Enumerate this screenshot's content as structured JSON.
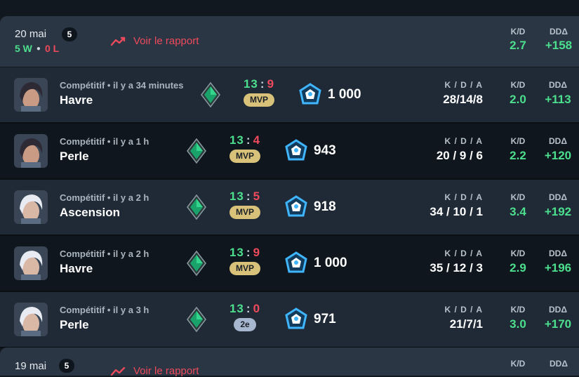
{
  "days": [
    {
      "date": "20 mai",
      "count": "5",
      "wins": "5 W",
      "losses": "0 L",
      "report": "Voir le rapport",
      "kd_label": "K/D",
      "kd": "2.7",
      "dd_label": "DDΔ",
      "dd": "+158"
    },
    {
      "date": "19 mai",
      "count": "5",
      "report": "Voir le rapport",
      "kd_label": "K/D",
      "dd_label": "DDΔ"
    }
  ],
  "matches": [
    {
      "sub": "Compétitif • il y a 34 minutes",
      "map": "Havre",
      "score_w": "13",
      "score_l": "9",
      "pill": "MVP",
      "rr": "1 000",
      "kda_label": "K / D / A",
      "kda": "28/14/8",
      "kd_label": "K/D",
      "kd": "2.0",
      "dd_label": "DDΔ",
      "dd": "+113"
    },
    {
      "sub": "Compétitif • il y a 1 h",
      "map": "Perle",
      "score_w": "13",
      "score_l": "4",
      "pill": "MVP",
      "rr": "943",
      "kda_label": "K / D / A",
      "kda": "20 / 9 / 6",
      "kd_label": "K/D",
      "kd": "2.2",
      "dd_label": "DDΔ",
      "dd": "+120"
    },
    {
      "sub": "Compétitif • il y a 2 h",
      "map": "Ascension",
      "score_w": "13",
      "score_l": "5",
      "pill": "MVP",
      "rr": "918",
      "kda_label": "K / D / A",
      "kda": "34 / 10 / 1",
      "kd_label": "K/D",
      "kd": "3.4",
      "dd_label": "DDΔ",
      "dd": "+192"
    },
    {
      "sub": "Compétitif • il y a 2 h",
      "map": "Havre",
      "score_w": "13",
      "score_l": "9",
      "pill": "MVP",
      "rr": "1 000",
      "kda_label": "K / D / A",
      "kda": "35 / 12 / 3",
      "kd_label": "K/D",
      "kd": "2.9",
      "dd_label": "DDΔ",
      "dd": "+196"
    },
    {
      "sub": "Compétitif • il y a 3 h",
      "map": "Perle",
      "score_w": "13",
      "score_l": "0",
      "pill": "2e",
      "rr": "971",
      "kda_label": "K / D / A",
      "kda": "21/7/1",
      "kd_label": "K/D",
      "kd": "3.0",
      "dd_label": "DDΔ",
      "dd": "+170"
    }
  ],
  "colors": {
    "win": "#4cdf8d",
    "loss": "#ef4a5c",
    "mvp": "#d8c27a",
    "position": "#a7b7cf",
    "header_bg": "#2a3644"
  },
  "icons": {
    "report": "trend-line-icon",
    "rank": "emerald-rank-icon",
    "rr": "rating-badge-icon",
    "avatar": "agent-portrait-icon"
  }
}
